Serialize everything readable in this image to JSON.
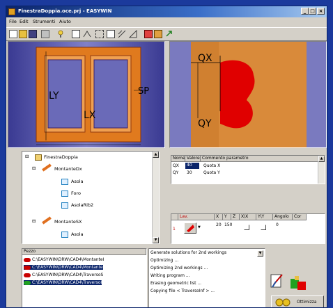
{
  "window": {
    "title": "FinestraDoppia.oce.prj - EASYWIN",
    "min_label": "_",
    "max_label": "□",
    "close_label": "×"
  },
  "menu": [
    "File",
    "Edit",
    "Strumenti",
    "Aiuto"
  ],
  "toolbar_icons": [
    "new-icon",
    "open-icon",
    "save-icon",
    "print-icon",
    "wizard-icon",
    "view1-icon",
    "view2-icon",
    "view3-icon",
    "view4-icon",
    "view5-icon",
    "view6-icon",
    "panel1-icon",
    "panel2-icon",
    "export-icon"
  ],
  "drawing_left": {
    "labels": {
      "ly": "LY",
      "lx": "LX",
      "sp": "SP"
    }
  },
  "drawing_right": {
    "labels": {
      "qx": "QX",
      "qy": "QY"
    }
  },
  "tree": {
    "items": [
      {
        "label": "FinestraDoppia",
        "level": 0,
        "icon": "project-icon"
      },
      {
        "label": "MontanteDx",
        "level": 1,
        "icon": "pencil-icon"
      },
      {
        "label": "Asola",
        "level": 2,
        "icon": "shape-icon"
      },
      {
        "label": "Foro",
        "level": 2,
        "icon": "shape-icon"
      },
      {
        "label": "AsolaRib2",
        "level": 2,
        "icon": "shape-icon"
      },
      {
        "label": "MontanteSX",
        "level": 1,
        "icon": "pencil-icon"
      },
      {
        "label": "Asola",
        "level": 2,
        "icon": "shape-icon"
      }
    ]
  },
  "params_table": {
    "headers": [
      "Nome",
      "Valore",
      "Commento parametro"
    ],
    "rows": [
      {
        "name": "QX",
        "value": "40",
        "comment": "Quota X"
      },
      {
        "name": "QY",
        "value": "30",
        "comment": "Quota Y"
      }
    ]
  },
  "work_table": {
    "headers": [
      "Lav.",
      "X",
      "Y",
      "Z",
      "X\\X",
      "Y\\Y",
      "Angolo",
      "Cor"
    ],
    "row": {
      "index": "1",
      "x": "20",
      "y": "150",
      "angle": "0"
    }
  },
  "pieces": {
    "header": "Pezzo",
    "items": [
      "C:\\EASYWIN\\DRW\\CAD4\\MontanteI",
      "C:\\EASYWIN\\DRW\\CAD4\\Montante",
      "C:\\EASYWIN\\DRW\\CAD4\\TraversoS",
      "C:\\EASYWIN\\DRW\\CAD4\\TraversoI"
    ]
  },
  "log": {
    "items": [
      "Generate solutions for 2nd workings",
      "Optimizing ...",
      "Optimizing 2nd workings ...",
      "Writing program ...",
      "Erasing geometric list ...",
      "Copying file < TraversoInf > ..."
    ]
  },
  "actions": {
    "ottimizza_label": "Ottimizza"
  },
  "colors": {
    "frame_orange": "#e07a1e",
    "glass_blue": "#5a5ab4",
    "wood": "#d98a3a",
    "tool_red": "#e00000"
  }
}
